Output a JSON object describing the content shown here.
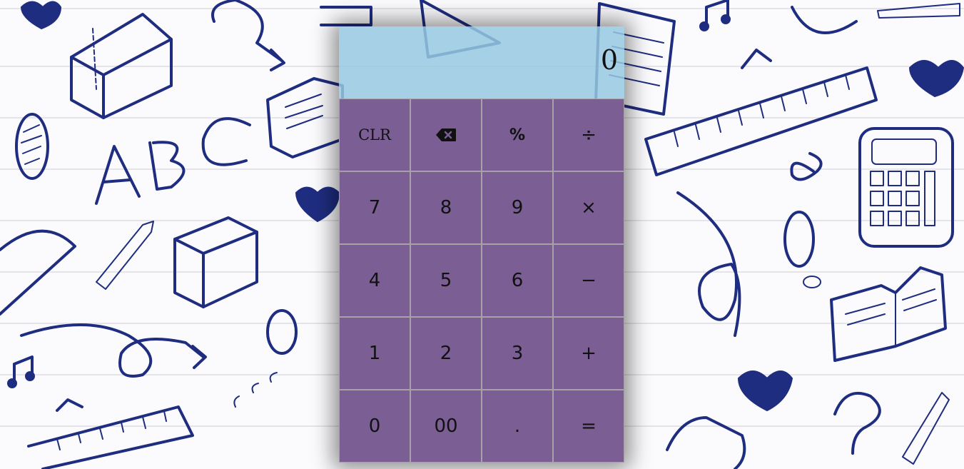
{
  "display": {
    "value": "0"
  },
  "keys": [
    {
      "label": "CLR",
      "name": "clear-button"
    },
    {
      "label": "",
      "name": "backspace-button",
      "icon": "backspace-icon"
    },
    {
      "label": "%",
      "name": "percent-button"
    },
    {
      "label": "÷",
      "name": "divide-button"
    },
    {
      "label": "7",
      "name": "seven-button"
    },
    {
      "label": "8",
      "name": "eight-button"
    },
    {
      "label": "9",
      "name": "nine-button"
    },
    {
      "label": "×",
      "name": "multiply-button"
    },
    {
      "label": "4",
      "name": "four-button"
    },
    {
      "label": "5",
      "name": "five-button"
    },
    {
      "label": "6",
      "name": "six-button"
    },
    {
      "label": "−",
      "name": "subtract-button"
    },
    {
      "label": "1",
      "name": "one-button"
    },
    {
      "label": "2",
      "name": "two-button"
    },
    {
      "label": "3",
      "name": "three-button"
    },
    {
      "label": "+",
      "name": "add-button"
    },
    {
      "label": "0",
      "name": "zero-button"
    },
    {
      "label": "00",
      "name": "double-zero-button"
    },
    {
      "label": ".",
      "name": "decimal-button"
    },
    {
      "label": "=",
      "name": "equals-button"
    }
  ],
  "background": {
    "doodle_letters": "ABC"
  },
  "colors": {
    "display_bg": "#96c8e1",
    "keypad_bg": "#7a5e94",
    "doodle_ink": "#1f2d80"
  }
}
